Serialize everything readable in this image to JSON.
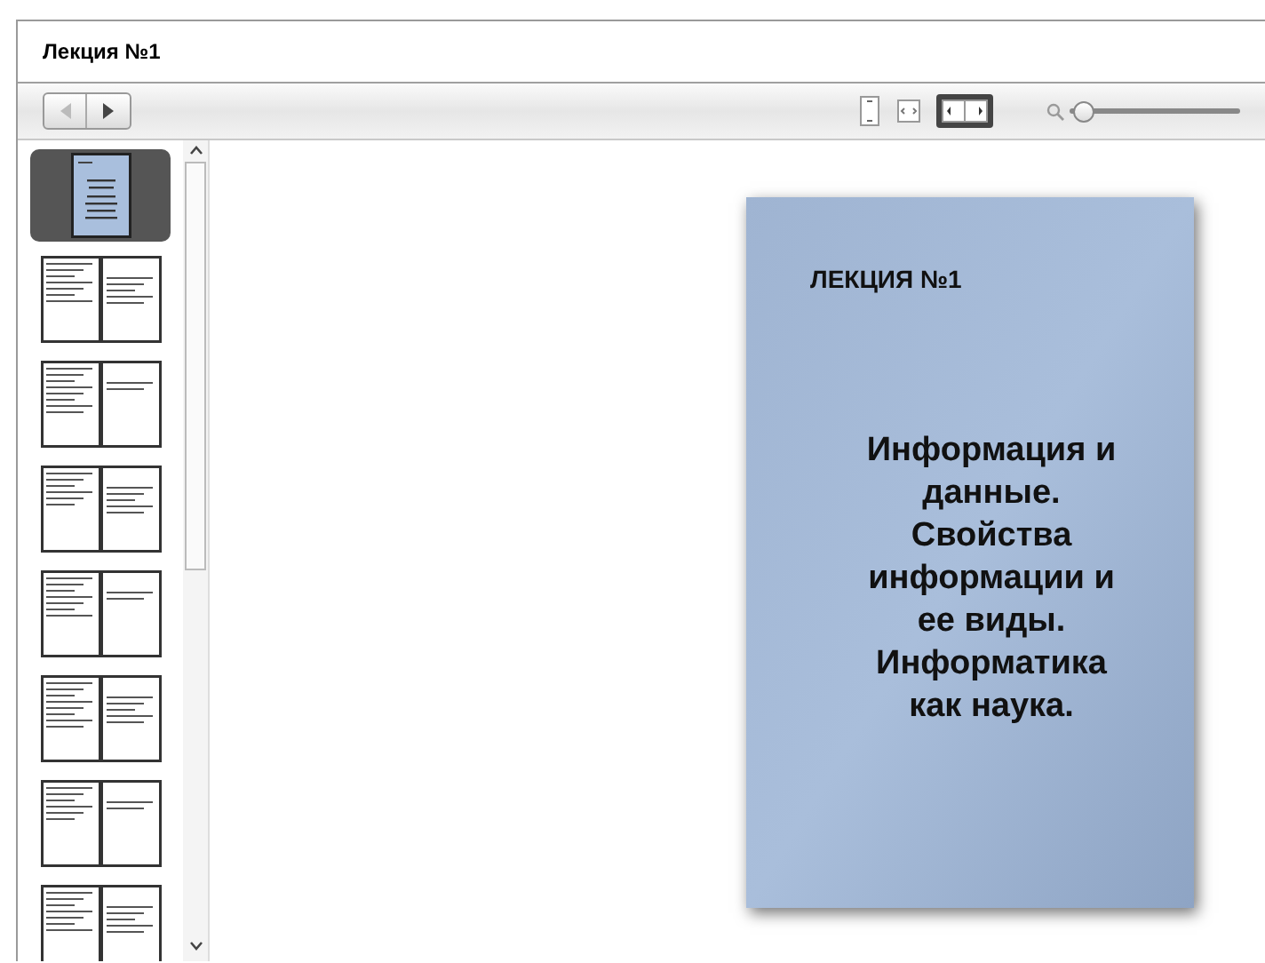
{
  "window": {
    "title": "Лекция №1"
  },
  "toolbar": {
    "view_modes": [
      {
        "kind": "single",
        "selected": false
      },
      {
        "kind": "fit",
        "selected": false
      },
      {
        "kind": "spread",
        "selected": true
      }
    ],
    "zoom": {
      "level": 0.02
    }
  },
  "thumbnails": [
    {
      "kind": "cover",
      "selected": true
    },
    {
      "kind": "spread",
      "selected": false
    },
    {
      "kind": "spread",
      "selected": false
    },
    {
      "kind": "spread",
      "selected": false
    },
    {
      "kind": "spread",
      "selected": false
    },
    {
      "kind": "spread",
      "selected": false
    },
    {
      "kind": "spread",
      "selected": false
    },
    {
      "kind": "spread",
      "selected": false
    }
  ],
  "page": {
    "heading": "ЛЕКЦИЯ №1",
    "title_lines": [
      "Информация и",
      "данные.",
      "Свойства",
      "информации и",
      "ее виды.",
      "Информатика",
      "как наука."
    ]
  }
}
